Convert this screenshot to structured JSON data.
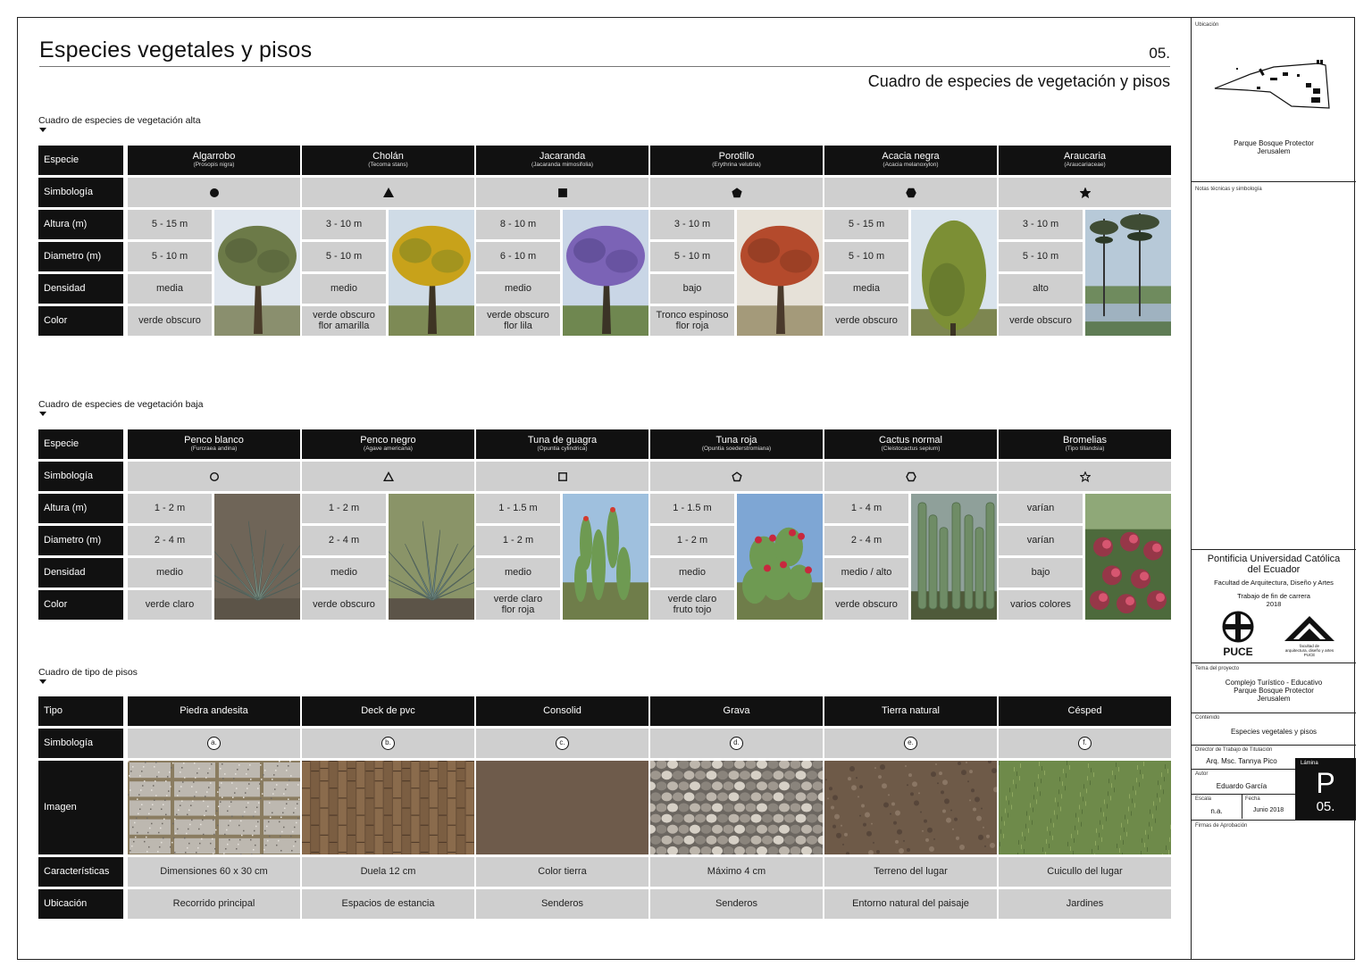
{
  "header": {
    "title": "Especies vegetales y pisos",
    "page_number": "05.",
    "subtitle": "Cuadro de especies de vegetación y pisos"
  },
  "high_veg": {
    "section_title": "Cuadro de especies de vegetación alta",
    "row_labels": [
      "Especie",
      "Simbología",
      "Altura (m)",
      "Diametro (m)",
      "Densidad",
      "Color"
    ],
    "species": [
      {
        "name": "Algarrobo",
        "sci": "(Prosopis nigra)",
        "symbol": "circle-filled",
        "altura": "5 - 15 m",
        "diametro": "5 - 10 m",
        "densidad": "media",
        "color_1": "verde obscuro",
        "color_2": ""
      },
      {
        "name": "Cholán",
        "sci": "(Tecoma stans)",
        "symbol": "triangle-filled",
        "altura": "3 - 10 m",
        "diametro": "5 - 10 m",
        "densidad": "medio",
        "color_1": "verde obscuro",
        "color_2": "flor amarilla"
      },
      {
        "name": "Jacaranda",
        "sci": "(Jacaranda mimosifolia)",
        "symbol": "square-filled",
        "altura": "8 - 10 m",
        "diametro": "6 - 10 m",
        "densidad": "medio",
        "color_1": "verde obscuro",
        "color_2": "flor lila"
      },
      {
        "name": "Porotillo",
        "sci": "(Erythrina velutina)",
        "symbol": "pentagon-filled",
        "altura": "3 - 10 m",
        "diametro": "5 - 10 m",
        "densidad": "bajo",
        "color_1": "Tronco espinoso",
        "color_2": "flor roja"
      },
      {
        "name": "Acacia negra",
        "sci": "(Acacia melanoxylon)",
        "symbol": "hexagon-filled",
        "altura": "5 - 15 m",
        "diametro": "5 - 10 m",
        "densidad": "media",
        "color_1": "verde obscuro",
        "color_2": ""
      },
      {
        "name": "Araucaria",
        "sci": "(Araucariaceae)",
        "symbol": "star-filled",
        "altura": "3 - 10 m",
        "diametro": "5 - 10 m",
        "densidad": "alto",
        "color_1": "verde obscuro",
        "color_2": ""
      }
    ]
  },
  "low_veg": {
    "section_title": "Cuadro de especies de vegetación baja",
    "row_labels": [
      "Especie",
      "Simbología",
      "Altura (m)",
      "Diametro (m)",
      "Densidad",
      "Color"
    ],
    "species": [
      {
        "name": "Penco blanco",
        "sci": "(Furcraea andina)",
        "symbol": "circle-outline",
        "altura": "1 - 2 m",
        "diametro": "2 - 4 m",
        "densidad": "medio",
        "color_1": "verde claro",
        "color_2": ""
      },
      {
        "name": "Penco negro",
        "sci": "(Agave americana)",
        "symbol": "triangle-outline",
        "altura": "1 - 2 m",
        "diametro": "2 - 4 m",
        "densidad": "medio",
        "color_1": "verde obscuro",
        "color_2": ""
      },
      {
        "name": "Tuna de guagra",
        "sci": "(Opuntia cylindrica)",
        "symbol": "square-outline",
        "altura": "1 - 1.5 m",
        "diametro": "1 - 2 m",
        "densidad": "medio",
        "color_1": "verde claro",
        "color_2": "flor roja"
      },
      {
        "name": "Tuna roja",
        "sci": "(Opuntia soederstromiana)",
        "symbol": "pentagon-outline",
        "altura": "1 - 1.5 m",
        "diametro": "1 - 2 m",
        "densidad": "medio",
        "color_1": "verde claro",
        "color_2": "fruto tojo"
      },
      {
        "name": "Cactus normal",
        "sci": "(Cleistocactus sepium)",
        "symbol": "hexagon-outline",
        "altura": "1 - 4 m",
        "diametro": "2 - 4 m",
        "densidad": "medio / alto",
        "color_1": "verde obscuro",
        "color_2": ""
      },
      {
        "name": "Bromelias",
        "sci": "(Tipo tillandsia)",
        "symbol": "star-outline",
        "altura": "varían",
        "diametro": "varían",
        "densidad": "bajo",
        "color_1": "varios colores",
        "color_2": ""
      }
    ]
  },
  "floors": {
    "section_title": "Cuadro de tipo de pisos",
    "row_labels": [
      "Tipo",
      "Simbología",
      "Imagen",
      "Características",
      "Ubicación"
    ],
    "types": [
      {
        "name": "Piedra andesita",
        "symbol": "a.",
        "caracteristicas": "Dimensiones 60 x 30 cm",
        "ubicacion": "Recorrido principal",
        "texture": "stone-tiles"
      },
      {
        "name": "Deck de pvc",
        "symbol": "b.",
        "caracteristicas": "Duela 12 cm",
        "ubicacion": "Espacios de estancia",
        "texture": "wood-deck"
      },
      {
        "name": "Consolid",
        "symbol": "c.",
        "caracteristicas": "Color tierra",
        "ubicacion": "Senderos",
        "texture": "solid-earth"
      },
      {
        "name": "Grava",
        "symbol": "d.",
        "caracteristicas": "Máximo 4 cm",
        "ubicacion": "Senderos",
        "texture": "gravel"
      },
      {
        "name": "Tierra natural",
        "symbol": "e.",
        "caracteristicas": "Terreno del lugar",
        "ubicacion": "Entorno natural del paisaje",
        "texture": "soil"
      },
      {
        "name": "Césped",
        "symbol": "f.",
        "caracteristicas": "Cuicullo del lugar",
        "ubicacion": "Jardines",
        "texture": "grass"
      }
    ]
  },
  "title_block": {
    "ubicacion_label": "Ubicación",
    "map_caption_1": "Parque Bosque Protector",
    "map_caption_2": "Jerusalem",
    "notas_label": "Notas técnicas y simbología",
    "university_1": "Pontificia Universidad Católica",
    "university_2": "del Ecuador",
    "faculty": "Facultad de Arquitectura, Diseño y Artes",
    "work_1": "Trabajo de fin de carrera",
    "work_2": "2018",
    "logo_puce_text": "PUCE",
    "logo_fac_text_1": "facultad de",
    "logo_fac_text_2": "arquitectura, diseño y artes",
    "logo_fac_text_3": "PUCE",
    "tema_label": "Tema del proyecto",
    "tema_1": "Complejo Turístico - Educativo",
    "tema_2": "Parque Bosque Protector",
    "tema_3": "Jerusalem",
    "contenido_label": "Contenido",
    "contenido": "Especies vegetales y pisos",
    "director_label": "Director de Trabajo de Titulación",
    "director": "Arq. Msc. Tannya Pico",
    "autor_label": "Autor",
    "autor": "Eduardo García",
    "escala_label": "Escala",
    "escala": "n.a.",
    "fecha_label": "Fecha",
    "fecha": "Junio 2018",
    "lamina_label": "Lámina",
    "lamina_letter": "P",
    "lamina_num": "05.",
    "firmas_label": "Firmas de Aprobación"
  }
}
